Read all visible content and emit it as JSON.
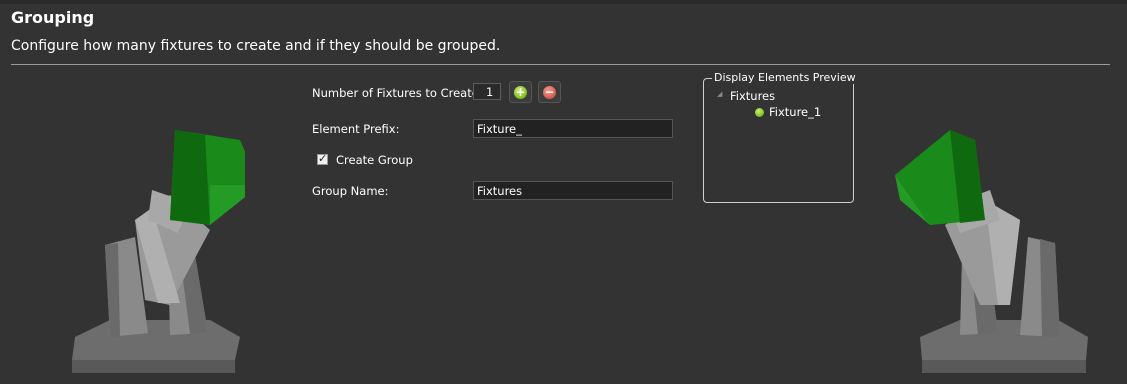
{
  "header": {
    "title": "Grouping",
    "subtitle": "Configure how many fixtures to create and if they should be grouped."
  },
  "form": {
    "fixture_count_label": "Number of Fixtures to Create:",
    "fixture_count_value": "1",
    "element_prefix_label": "Element Prefix:",
    "element_prefix_value": "Fixture_",
    "create_group_label": "Create Group",
    "create_group_checked": true,
    "group_name_label": "Group Name:",
    "group_name_value": "Fixtures"
  },
  "preview": {
    "title": "Display Elements Preview",
    "root": "Fixtures",
    "children": [
      "Fixture_1"
    ]
  },
  "icons": {
    "increment": "plus-circle-icon",
    "decrement": "minus-circle-icon",
    "tree_item": "green-dot-icon",
    "decoration": "moving-head-light-icon"
  },
  "colors": {
    "background": "#333333",
    "add_green": "#7fbd17",
    "remove_red": "#d65a4b",
    "fixture_lens_green": "#1a8a1a"
  }
}
